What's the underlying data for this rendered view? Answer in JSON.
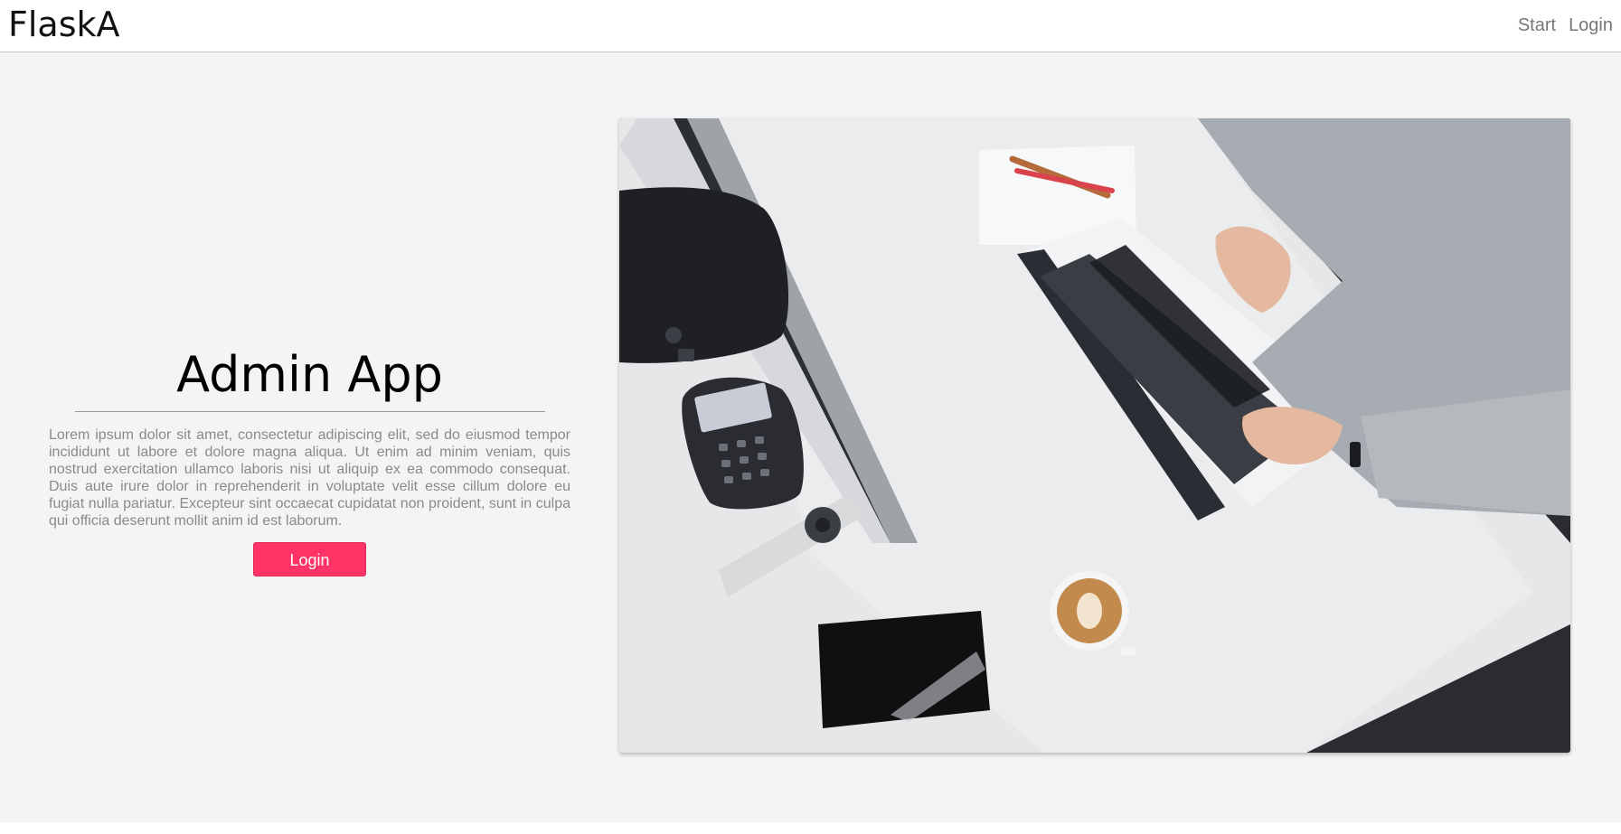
{
  "navbar": {
    "brand": "FlaskA",
    "links": [
      "Start",
      "Login"
    ]
  },
  "hero": {
    "title": "Admin App",
    "text": "Lorem ipsum dolor sit amet, consectetur adipiscing elit, sed do eiusmod tempor incididunt ut labore et dolore magna aliqua. Ut enim ad minim veniam, quis nostrud exercitation ullamco laboris nisi ut aliquip ex ea commodo consequat. Duis aute irure dolor in reprehenderit in voluptate velit esse cillum dolore eu fugiat nulla pariatur. Excepteur sint occaecat cupidatat non proident, sunt in culpa qui officia deserunt mollit anim id est laborum.",
    "button_label": "Login"
  },
  "colors": {
    "accent": "#ff3366",
    "background": "#f4f4f4"
  }
}
